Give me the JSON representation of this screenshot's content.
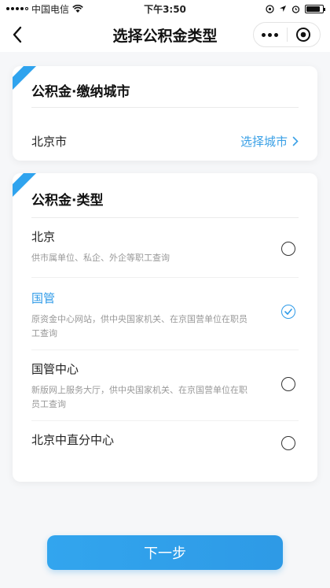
{
  "status_bar": {
    "carrier": "中国电信",
    "time": "下午3:50",
    "battery_level": 0.85
  },
  "nav": {
    "title": "选择公积金类型"
  },
  "city_card": {
    "title": "公积金·缴纳城市",
    "city_value": "北京市",
    "select_label": "选择城市"
  },
  "type_card": {
    "title": "公积金·类型",
    "options": [
      {
        "title": "北京",
        "desc": "供市属单位、私企、外企等职工查询",
        "selected": false
      },
      {
        "title": "国管",
        "desc": "原资金中心网站，供中央国家机关、在京国营单位在职员工查询",
        "selected": true
      },
      {
        "title": "国管中心",
        "desc": "新版网上服务大厅，供中央国家机关、在京国营单位在职员工查询",
        "selected": false
      },
      {
        "title": "北京中直分中心",
        "desc": "",
        "selected": false
      }
    ]
  },
  "footer": {
    "next_label": "下一步"
  },
  "colors": {
    "accent": "#2f9be8",
    "ribbon": "#2fa3ee"
  }
}
